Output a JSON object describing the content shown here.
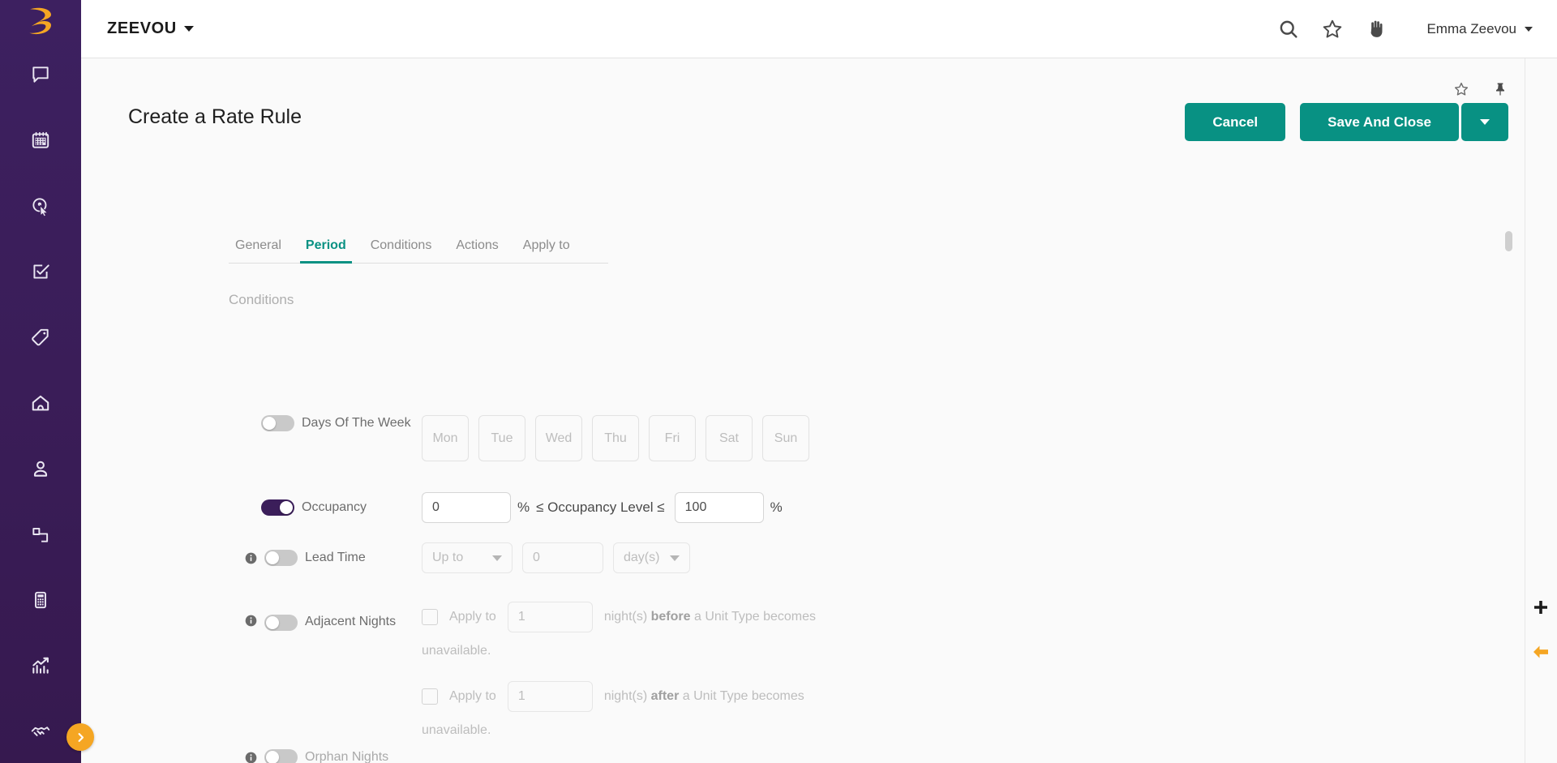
{
  "app": {
    "brand": "ZEEVOU",
    "user": "Emma Zeevou"
  },
  "topbar": {
    "search_icon": "search-icon",
    "favourite_icon": "star-icon",
    "hand_icon": "hand-icon",
    "brand_caret": "chevron-down-icon"
  },
  "sidebar": {
    "logo": "zeevou-logo",
    "items": [
      {
        "icon": "chat-bubble-icon",
        "name": "inbox"
      },
      {
        "icon": "calendar-icon",
        "name": "calendar"
      },
      {
        "icon": "cursor-click-icon",
        "name": "bookings"
      },
      {
        "icon": "checklist-icon",
        "name": "tasks"
      },
      {
        "icon": "tag-icon",
        "name": "rates"
      },
      {
        "icon": "home-icon",
        "name": "properties"
      },
      {
        "icon": "user-icon",
        "name": "guests"
      },
      {
        "icon": "link-copy-icon",
        "name": "channels"
      },
      {
        "icon": "calculator-icon",
        "name": "finance"
      },
      {
        "icon": "analytics-chart-icon",
        "name": "reports"
      },
      {
        "icon": "handshake-icon",
        "name": "partners"
      }
    ],
    "expand_button": "chevron-right-icon"
  },
  "page": {
    "title": "Create a Rate Rule",
    "favourite_icon": "star-outline-icon",
    "pin_icon": "pin-icon",
    "cancel_label": "Cancel",
    "save_label": "Save And Close",
    "save_dropdown_icon": "chevron-down-icon"
  },
  "tabs": [
    {
      "label": "General",
      "active": false
    },
    {
      "label": "Period",
      "active": true
    },
    {
      "label": "Conditions",
      "active": false
    },
    {
      "label": "Actions",
      "active": false
    },
    {
      "label": "Apply to",
      "active": false
    }
  ],
  "section": {
    "label": "Conditions"
  },
  "conditions": {
    "days_of_week": {
      "label": "Days Of The Week",
      "enabled": false,
      "days": [
        "Mon",
        "Tue",
        "Wed",
        "Thu",
        "Fri",
        "Sat",
        "Sun"
      ]
    },
    "occupancy": {
      "label": "Occupancy",
      "enabled": true,
      "min_value": "0",
      "max_value": "100",
      "percent_symbol": "%",
      "middle_text": "≤ Occupancy Level ≤"
    },
    "lead_time": {
      "label": "Lead Time",
      "enabled": false,
      "info_icon": "info-icon",
      "comparator": "Up to",
      "value": "0",
      "unit": "day(s)"
    },
    "adjacent_nights": {
      "label": "Adjacent Nights",
      "enabled": false,
      "info_icon": "info-icon",
      "before": {
        "checked": false,
        "apply_to": "Apply to",
        "value": "1",
        "nights": "night(s)",
        "emphasis": "before",
        "tail": "a Unit Type becomes",
        "tail2": "unavailable."
      },
      "after": {
        "checked": false,
        "apply_to": "Apply to",
        "value": "1",
        "nights": "night(s)",
        "emphasis": "after",
        "tail": "a Unit Type becomes",
        "tail2": "unavailable."
      }
    },
    "orphan_nights": {
      "label": "Orphan Nights",
      "enabled": false,
      "info_icon": "info-icon"
    }
  },
  "floating": {
    "add_icon": "plus-icon",
    "back_icon": "arrow-left-icon"
  },
  "colors": {
    "sidebar": "#3b1e5a",
    "accent_teal": "#089183",
    "logo_orange": "#f5a623",
    "toggle_on": "#3b1e5a"
  }
}
